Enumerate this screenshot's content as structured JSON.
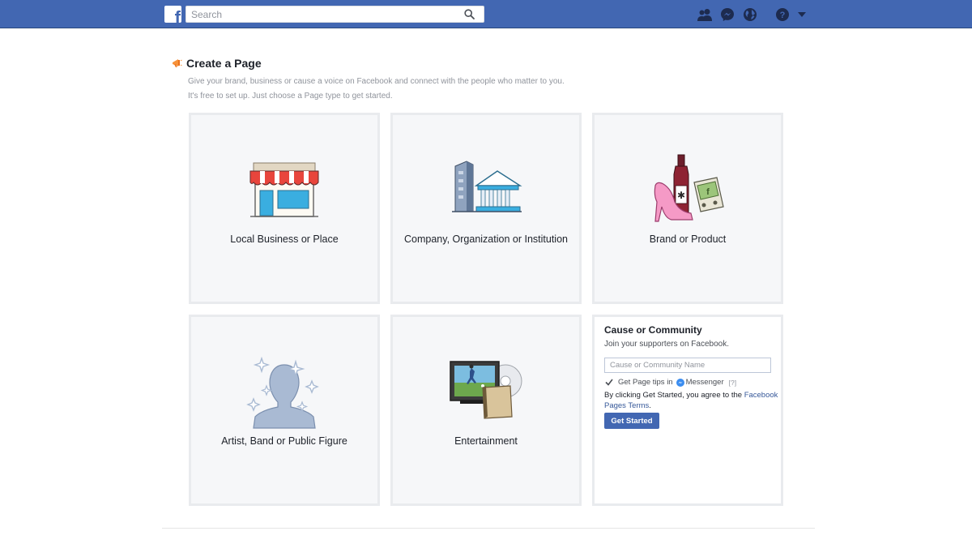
{
  "topbar": {
    "logo_letter": "f",
    "search_placeholder": "Search",
    "icons": [
      "friends-icon",
      "messenger-icon",
      "globe-icon",
      "help-icon",
      "caret-down-icon"
    ],
    "brand_color": "#4267b2"
  },
  "page": {
    "title": "Create a Page",
    "subtitle_line1": "Give your brand, business or cause a voice on Facebook and connect with the people who matter to you.",
    "subtitle_line2": "It's free to set up. Just choose a Page type to get started."
  },
  "tiles": [
    {
      "label": "Local Business or Place",
      "icon": "storefront-icon"
    },
    {
      "label": "Company, Organization or Institution",
      "icon": "buildings-icon"
    },
    {
      "label": "Brand or Product",
      "icon": "products-icon"
    },
    {
      "label": "Artist, Band or Public Figure",
      "icon": "artist-silhouette-icon"
    },
    {
      "label": "Entertainment",
      "icon": "tv-media-icon"
    }
  ],
  "cause": {
    "title": "Cause or Community",
    "subtitle": "Join your supporters on Facebook.",
    "input_placeholder": "Cause or Community Name",
    "tips_text": "Get Page tips in",
    "messenger_label": "Messenger",
    "help": "[?]",
    "terms_prefix": "By clicking Get Started, you agree to the",
    "terms_link": "Facebook Pages Terms",
    "terms_suffix": ".",
    "button_label": "Get Started"
  }
}
